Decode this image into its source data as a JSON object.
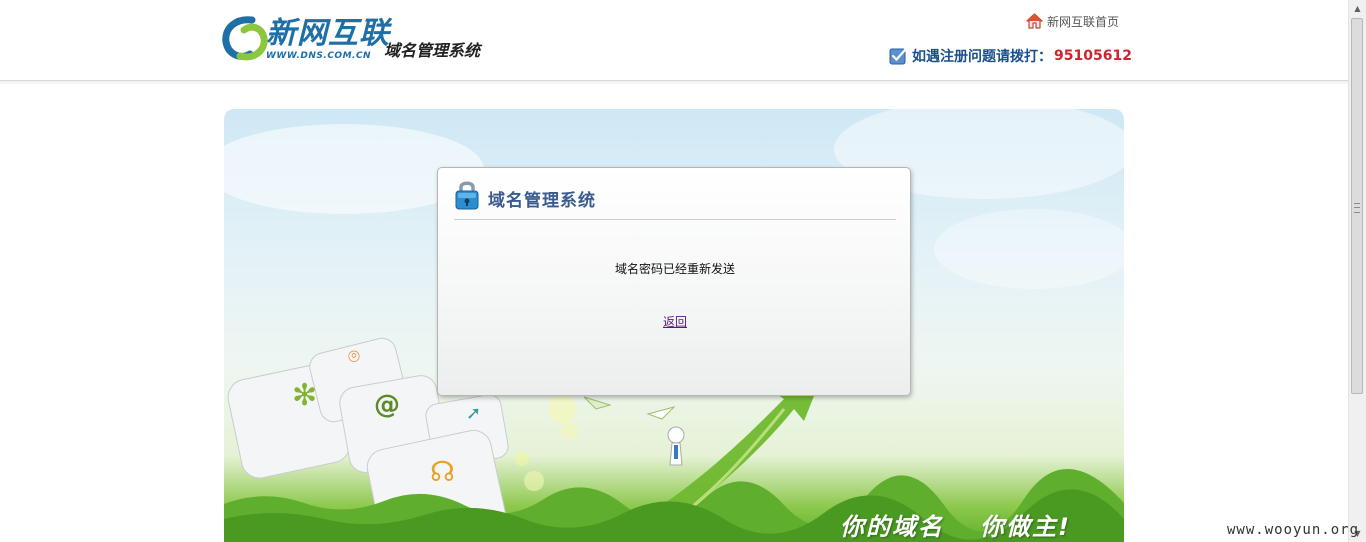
{
  "header": {
    "logo_name": "新网互联",
    "logo_url": "WWW.DNS.COM.CN",
    "system_name": "域名管理系统",
    "home_link": "新网互联首页",
    "hotline_label": "如遇注册问题请拨打：",
    "hotline_number": "95105612"
  },
  "dialog": {
    "title": "域名管理系统",
    "message": "域名密码已经重新发送",
    "back_label": "返回"
  },
  "banner": {
    "slogan_part1": "你的域名",
    "slogan_part2": "你做主!",
    "key_icons": [
      "asterisk-icon",
      "mouse-icon",
      "at-sign-icon",
      "arrow-icon",
      "headset-icon"
    ]
  },
  "watermark": "www.wooyun.org",
  "colors": {
    "brand_blue": "#1e6fa6",
    "title_blue": "#3b5b8e",
    "hotline_red": "#d0232a",
    "link_purple": "#5a1b7a",
    "grass_green": "#5fae2e"
  }
}
